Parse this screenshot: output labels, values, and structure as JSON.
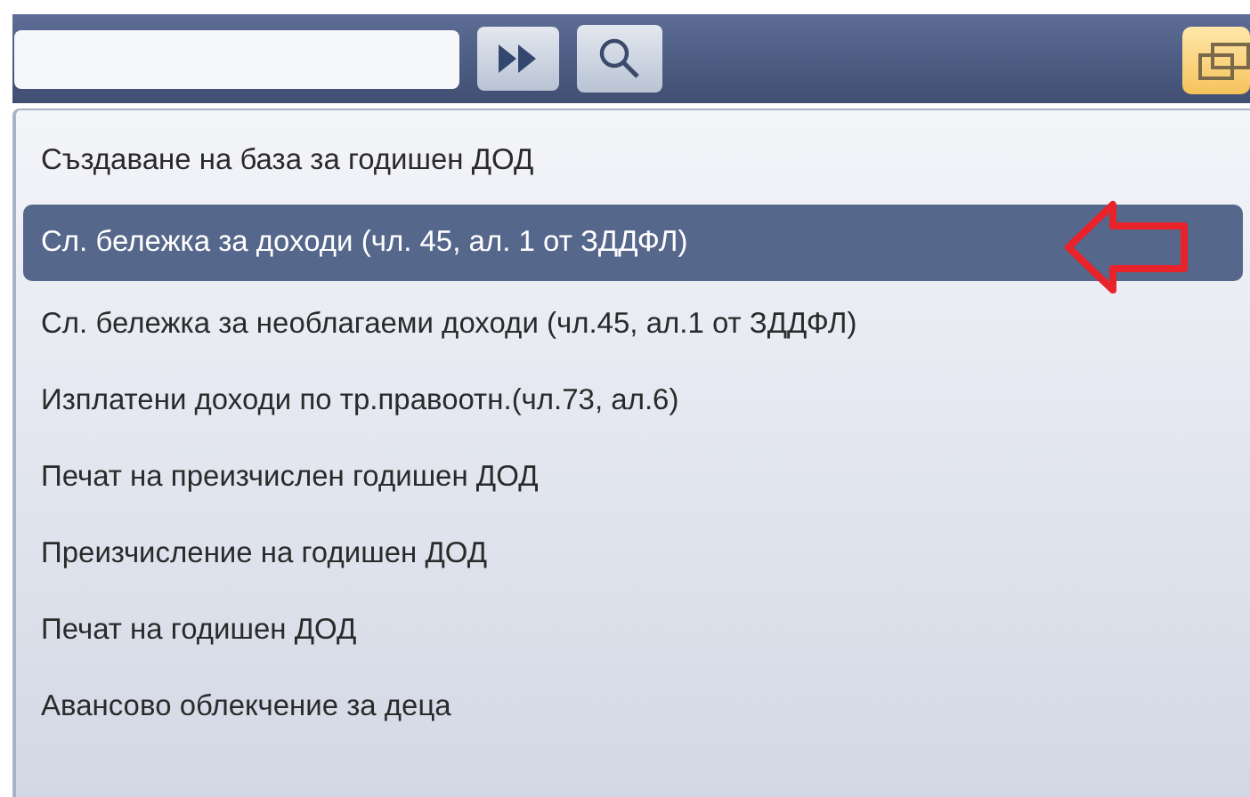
{
  "menu": {
    "items": [
      {
        "label": "Създаване на база за годишен ДОД",
        "selected": false
      },
      {
        "label": "Сл. бележка за доходи (чл. 45, ал. 1 от ЗДДФЛ)",
        "selected": true
      },
      {
        "label": "Сл. бележка за необлагаеми доходи (чл.45, ал.1 от ЗДДФЛ)",
        "selected": false
      },
      {
        "label": "Изплатени доходи по тр.правоотн.(чл.73, ал.6)",
        "selected": false
      },
      {
        "label": "Печат на преизчислен годишен ДОД",
        "selected": false
      },
      {
        "label": "Преизчисление на годишен ДОД",
        "selected": false
      },
      {
        "label": "Печат на годишен ДОД",
        "selected": false
      },
      {
        "label": "Авансово облекчение за деца",
        "selected": false
      }
    ]
  }
}
